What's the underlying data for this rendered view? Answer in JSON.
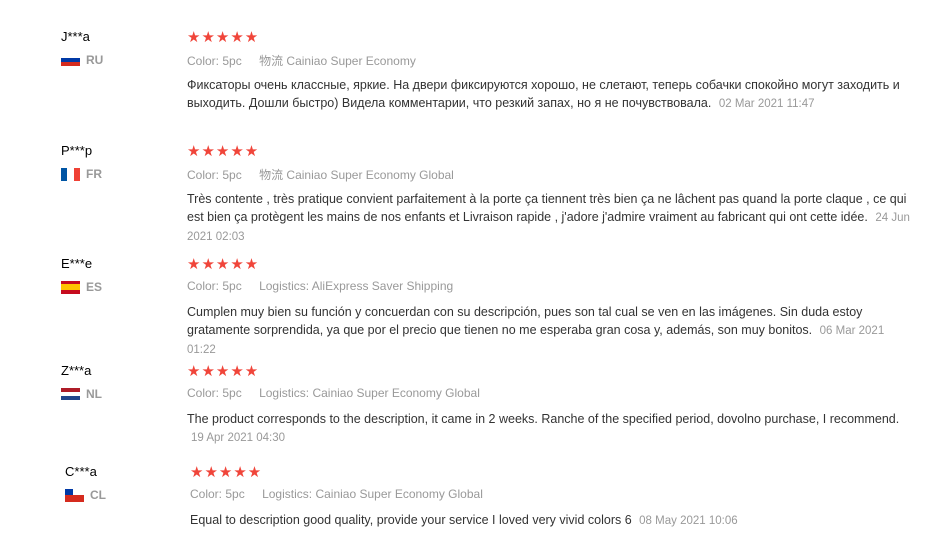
{
  "reviews": [
    {
      "user": "J***a",
      "country": "RU",
      "stars": "★★★★★",
      "meta_key1": "Color:",
      "meta_val1": "5pc",
      "meta_key2": "物流",
      "meta_val2": "Cainiao Super Economy",
      "text": "Фиксаторы очень классные, яркие. На двери фиксируются хорошо, не слетают, теперь собачки спокойно могут заходить и выходить. Дошли быстро) Видела комментарии, что резкий запах, но я не почувствовала.",
      "date": "02 Mar 2021 11:47"
    },
    {
      "user": "P***p",
      "country": "FR",
      "stars": "★★★★★",
      "meta_key1": "Color:",
      "meta_val1": "5pc",
      "meta_key2": "物流",
      "meta_val2": "Cainiao Super Economy Global",
      "text": "Très contente , très pratique convient parfaitement à la porte ça tiennent très bien ça ne lâchent pas quand la porte claque , ce qui est bien ça protègent les mains de nos enfants et Livraison rapide , j'adore j'admire vraiment au fabricant qui ont cette idée.",
      "date": "24 Jun 2021 02:03"
    },
    {
      "user": "E***e",
      "country": "ES",
      "stars": "★★★★★",
      "meta_key1": "Color:",
      "meta_val1": "5pc",
      "meta_key2": "Logistics:",
      "meta_val2": "AliExpress Saver Shipping",
      "text": "Cumplen muy bien su función y concuerdan con su descripción, pues son tal cual se ven en las imágenes. Sin duda estoy gratamente sorprendida, ya que por el precio que tienen no me esperaba gran cosa y, además, son muy bonitos.",
      "date": "06 Mar 2021 01:22"
    },
    {
      "user": "Z***a",
      "country": "NL",
      "stars": "★★★★★",
      "meta_key1": "Color:",
      "meta_val1": "5pc",
      "meta_key2": "Logistics:",
      "meta_val2": "Cainiao Super Economy Global",
      "text": "The product corresponds to the description, it came in 2 weeks. Ranche of the specified period, dovolno purchase, I recommend.",
      "date": "19 Apr 2021 04:30"
    },
    {
      "user": "C***a",
      "country": "CL",
      "stars": "★★★★★",
      "meta_key1": "Color:",
      "meta_val1": "5pc",
      "meta_key2": "Logistics:",
      "meta_val2": "Cainiao Super Economy Global",
      "text": "Equal to description good quality, provide your service I loved very vivid colors 6",
      "date": "08 May 2021 10:06"
    }
  ],
  "colors": {
    "star": "#f0453a",
    "muted": "#999999",
    "text": "#333333"
  }
}
